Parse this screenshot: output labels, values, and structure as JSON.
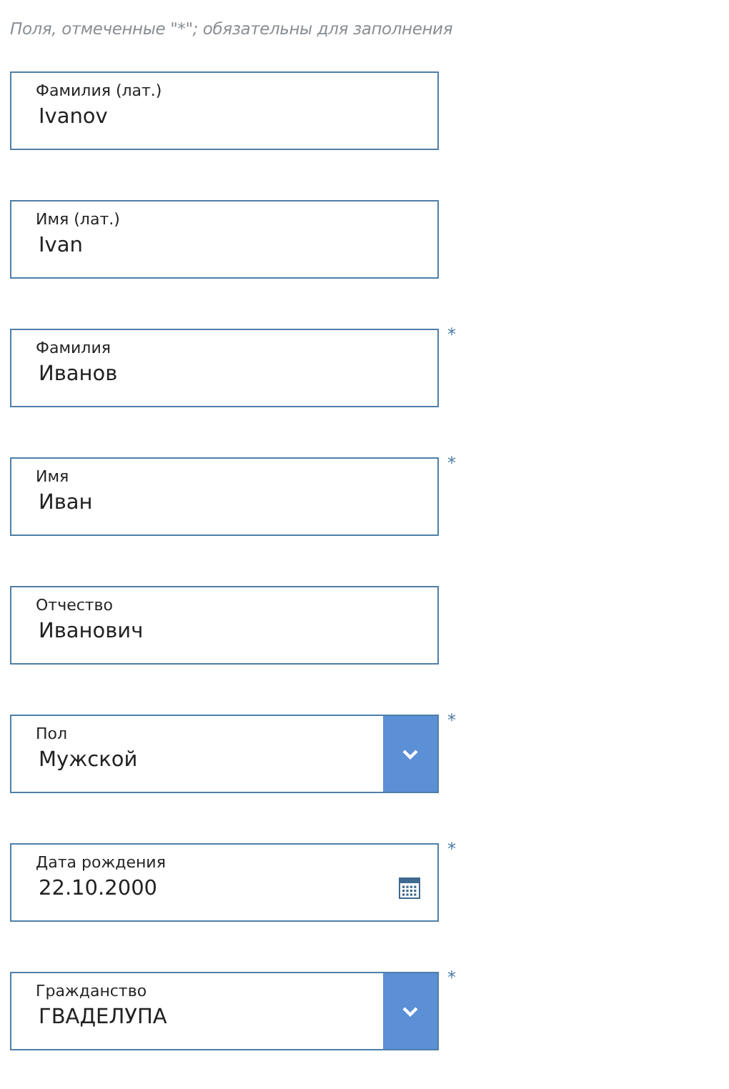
{
  "note": "Поля, отмеченные \"*\"; обязательны для заполнения",
  "fields": [
    {
      "kind": "text",
      "label": "Фамилия (лат.)",
      "value": "Ivanov"
    },
    {
      "kind": "text",
      "label": "Имя (лат.)",
      "value": "Ivan"
    },
    {
      "kind": "text",
      "label": "Фамилия",
      "value": "Иванов",
      "required_mark": "*"
    },
    {
      "kind": "text",
      "label": "Имя",
      "value": "Иван",
      "required_mark": "*"
    },
    {
      "kind": "text",
      "label": "Отчество",
      "value": "Иванович"
    },
    {
      "kind": "select",
      "label": "Пол",
      "value": "Мужской",
      "required_mark": "*"
    },
    {
      "kind": "date",
      "label": "Дата рождения",
      "value": "22.10.2000",
      "required_mark": "*"
    },
    {
      "kind": "select",
      "label": "Гражданство",
      "value": "ГВАДЕЛУПА",
      "required_mark": "*"
    }
  ]
}
